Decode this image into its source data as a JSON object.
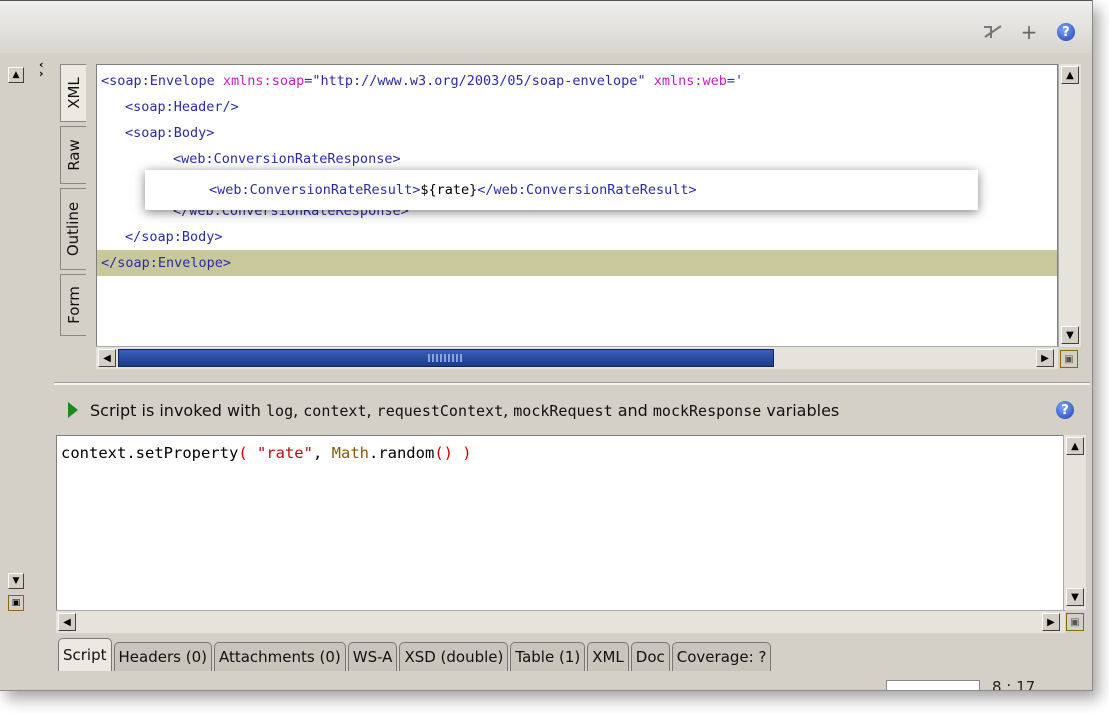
{
  "toolbar": {
    "icons": [
      "validate-icon",
      "add-icon",
      "help-icon"
    ],
    "add_glyph": "+",
    "help_glyph": "?"
  },
  "editor_tabs": [
    "XML",
    "Raw",
    "Outline",
    "Form"
  ],
  "xml": {
    "line1_tag": "<soap:Envelope ",
    "line1_attr1": "xmlns:soap",
    "line1_val1": "=\"http://www.w3.org/2003/05/soap-envelope\" ",
    "line1_attr2": "xmlns:web",
    "line1_val2": "='",
    "line2": "<soap:Header/>",
    "line3": "<soap:Body>",
    "line4": "<web:ConversionRateResponse>",
    "line5_open": "<web:ConversionRateResult>",
    "line5_value": "${rate}",
    "line5_close": "</web:ConversionRateResult>",
    "line6": "</web:ConversionRateResponse>",
    "line7": "</soap:Body>",
    "line8": "</soap:Envelope>"
  },
  "script_info": {
    "prefix": "Script is invoked with ",
    "v1": "log",
    "sep1": ", ",
    "v2": "context",
    "sep2": ", ",
    "v3": "requestContext",
    "sep3": ", ",
    "v4": "mockRequest",
    "mid": " and ",
    "v5": "mockResponse",
    "suffix": " variables"
  },
  "script": {
    "obj": "context.setProperty",
    "p_open": "( ",
    "str": "\"rate\"",
    "comma": ", ",
    "cls": "Math",
    "method": ".random",
    "call": "() )"
  },
  "bottom_tabs": [
    "Script",
    "Headers (0)",
    "Attachments (0)",
    "WS-A",
    "XSD (double)",
    "Table (1)",
    "XML",
    "Doc",
    "Coverage: ?"
  ],
  "active_bottom_tab": "Script",
  "status": {
    "position": "8 : 17"
  }
}
